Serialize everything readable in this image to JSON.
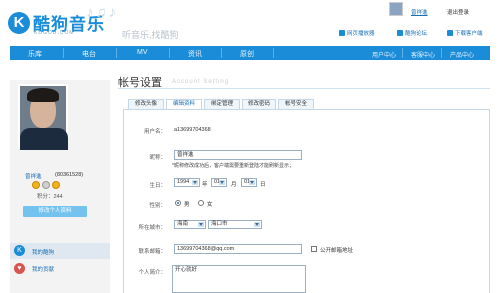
{
  "header": {
    "logo_letter": "K",
    "logo_text": "酷狗音乐",
    "logo_sub": "KUGOU.COM",
    "notes": "♪♫♪",
    "slogan": "听音乐,找酷狗",
    "user_name": "曾祥進",
    "logout": "退出登录",
    "links": [
      "网页播放器",
      "酷狗论坛",
      "下载客户端"
    ]
  },
  "nav": {
    "items": [
      "乐库",
      "电台",
      "MV",
      "资讯",
      "原创"
    ],
    "right": [
      "用户中心",
      "客服中心",
      "产品中心"
    ]
  },
  "sidebar": {
    "user_name": "曾祥進",
    "user_id": "(80361528)",
    "points_label": "积分：244",
    "edit_button": "修改个人资料",
    "items": [
      {
        "label": "我的酷狗",
        "icon": "K"
      },
      {
        "label": "我的贡献",
        "icon": "♥"
      }
    ]
  },
  "page": {
    "title": "帐号设置",
    "title_en": "Account Setting",
    "tabs": [
      "修改头像",
      "编辑资料",
      "绑定管理",
      "修改密码",
      "帐号安全"
    ],
    "active_tab": 1
  },
  "form": {
    "username_label": "用户名：",
    "username_value": "a13699704368",
    "nickname_label": "昵称：",
    "nickname_value": "曾祥進",
    "nickname_hint": "*昵称修改成功后，客户端需要重新登陆才能刷新显示；",
    "birthday_label": "生日：",
    "birth_year": "1994",
    "year_unit": "年",
    "birth_month": "01",
    "month_unit": "月",
    "birth_day": "01",
    "day_unit": "日",
    "gender_label": "性别：",
    "gender_male": "男",
    "gender_female": "女",
    "city_label": "所在城市：",
    "province": "海南",
    "city": "海口市",
    "email_label": "联系邮箱：",
    "email_value": "13699704368@qq.com",
    "email_public": "公开邮箱地址",
    "intro_label": "个人简介：",
    "intro_value": "开心就好"
  },
  "colors": {
    "brand": "#1a8cd8",
    "nav_bg": "#1a8cd8",
    "link": "#1a6fb5"
  }
}
